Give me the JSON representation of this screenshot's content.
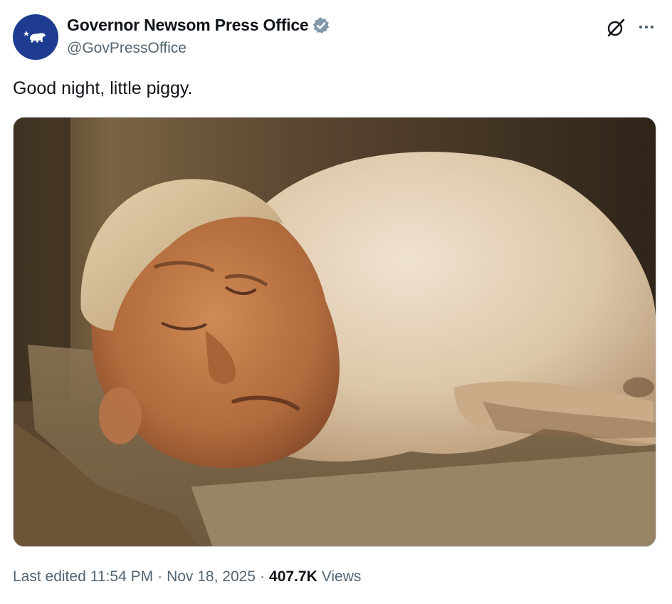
{
  "author": {
    "display_name": "Governor Newsom Press Office",
    "handle": "@GovPressOffice",
    "avatar_icon": "california-bear-icon",
    "verified_icon": "verified-badge-icon",
    "avatar_color": "#1d3c8f",
    "verified_color": "#829aab"
  },
  "actions": {
    "grok_icon": "grok-icon",
    "more_icon": "more-options-icon"
  },
  "tweet": {
    "text": "Good night, little piggy."
  },
  "media": {
    "alt": "Image of a pig with a human head sleeping in a barn",
    "kind": "photo"
  },
  "meta": {
    "edited_label": "Last edited",
    "time": "11:54 PM",
    "separator": "·",
    "date": "Nov 18, 2025",
    "views_count": "407.7K",
    "views_label": "Views"
  }
}
